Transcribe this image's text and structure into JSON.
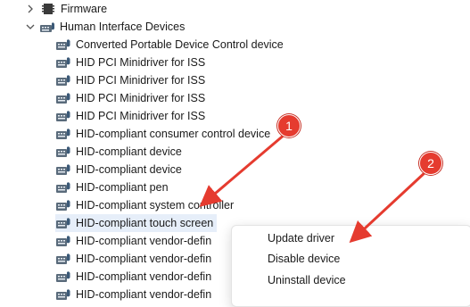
{
  "tree": {
    "firmware": {
      "label": "Firmware",
      "icon": "firmware-chip-icon"
    },
    "hid_group": {
      "label": "Human Interface Devices",
      "icon": "hid-category-icon"
    },
    "devices": [
      "Converted Portable Device Control device",
      "HID PCI Minidriver for ISS",
      "HID PCI Minidriver for ISS",
      "HID PCI Minidriver for ISS",
      "HID PCI Minidriver for ISS",
      "HID-compliant consumer control device",
      "HID-compliant device",
      "HID-compliant device",
      "HID-compliant pen",
      "HID-compliant system controller",
      "HID-compliant touch screen",
      "HID-compliant vendor-defin",
      "HID-compliant vendor-defin",
      "HID-compliant vendor-defin",
      "HID-compliant vendor-defin"
    ],
    "selected_index": 10,
    "device_icon": "hid-device-icon"
  },
  "context_menu": {
    "items": [
      "Update driver",
      "Disable device",
      "Uninstall device"
    ]
  },
  "callouts": [
    "1",
    "2"
  ],
  "colors": {
    "callout": "#e53b2f",
    "selection": "#e6eef9",
    "device_icon": "#5a6b7b"
  }
}
